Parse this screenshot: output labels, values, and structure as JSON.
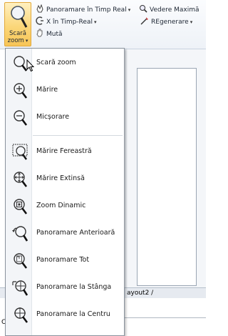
{
  "ribbon": {
    "zoom_button_label_line1": "Scară",
    "zoom_button_label_line2": "zoom",
    "pan_realtime": "Panoramare în Timp Real",
    "x_realtime": "X în Timp-Real",
    "move": "Mută",
    "max_view": "Vedere Maximă",
    "regenerate": "REgenerare"
  },
  "menu": {
    "items": [
      {
        "label": "Scară zoom",
        "icon": "zoom-scale-icon"
      },
      {
        "label": "Mărire",
        "icon": "zoom-in-icon"
      },
      {
        "label": "Micșorare",
        "icon": "zoom-out-icon"
      },
      {
        "label": "Mărire Fereastră",
        "icon": "zoom-window-icon"
      },
      {
        "label": "Mărire Extinsă",
        "icon": "zoom-extents-icon"
      },
      {
        "label": "Zoom Dinamic",
        "icon": "zoom-dynamic-icon"
      },
      {
        "label": "Panoramare Anterioară",
        "icon": "zoom-previous-icon"
      },
      {
        "label": "Panoramare Tot",
        "icon": "zoom-all-icon"
      },
      {
        "label": "Panoramare la Stânga",
        "icon": "pan-left-icon"
      },
      {
        "label": "Panoramare la Centru",
        "icon": "pan-center-icon"
      }
    ]
  },
  "workspace": {
    "layout_tab": "ayout2 /",
    "command_prefix": "C"
  }
}
